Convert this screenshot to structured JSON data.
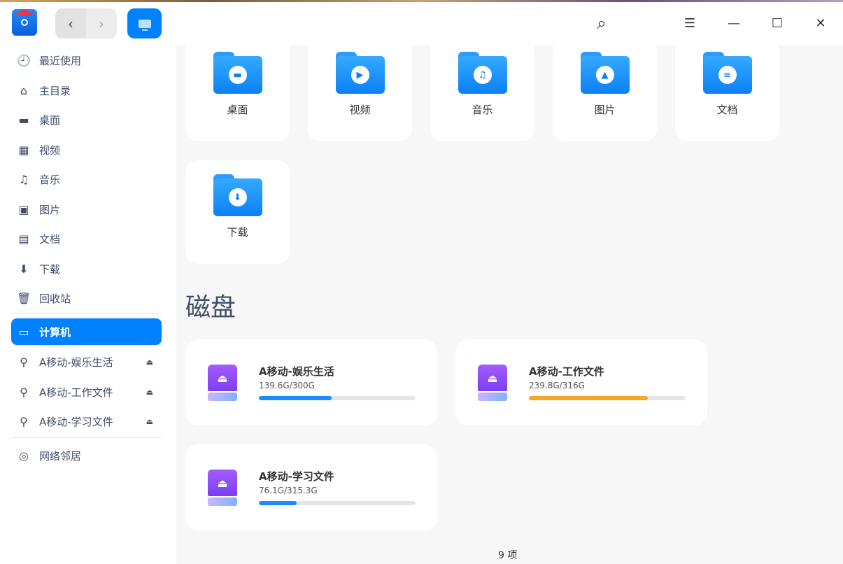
{
  "titlebar": {
    "app_icon": "file-manager-icon",
    "back": "‹",
    "forward": "›",
    "computer_icon": "computer-icon",
    "search_icon": "⌕",
    "menu_icon": "☰",
    "min_icon": "—",
    "max_icon": "☐",
    "close_icon": "✕"
  },
  "sidebar": {
    "items": [
      {
        "label": "最近使用",
        "icon": "🕘"
      },
      {
        "label": "主目录",
        "icon": "⌂"
      },
      {
        "label": "桌面",
        "icon": "▬"
      },
      {
        "label": "视频",
        "icon": "▦"
      },
      {
        "label": "音乐",
        "icon": "♫"
      },
      {
        "label": "图片",
        "icon": "▣"
      },
      {
        "label": "文档",
        "icon": "▤"
      },
      {
        "label": "下载",
        "icon": "⬇"
      },
      {
        "label": "回收站",
        "icon": "🗑"
      },
      {
        "label": "计算机",
        "icon": "▭"
      },
      {
        "label": "A移动-娱乐生活",
        "icon": "⚲"
      },
      {
        "label": "A移动-工作文件",
        "icon": "⚲"
      },
      {
        "label": "A移动-学习文件",
        "icon": "⚲"
      },
      {
        "label": "网络邻居",
        "icon": "◎"
      }
    ],
    "eject_icon": "⏏"
  },
  "folders": [
    {
      "label": "桌面",
      "icon": "▬"
    },
    {
      "label": "视频",
      "icon": "▶"
    },
    {
      "label": "音乐",
      "icon": "♫"
    },
    {
      "label": "图片",
      "icon": "▲"
    },
    {
      "label": "文档",
      "icon": "≡"
    },
    {
      "label": "下载",
      "icon": "⬇"
    }
  ],
  "disks_title": "磁盘",
  "disks": [
    {
      "name": "A移动-娱乐生活",
      "size": "139.6G/300G",
      "used_fraction": 0.465,
      "color": "#1a8cff"
    },
    {
      "name": "A移动-工作文件",
      "size": "239.8G/316G",
      "used_fraction": 0.759,
      "color": "#f5a623"
    },
    {
      "name": "A移动-学习文件",
      "size": "76.1G/315.3G",
      "used_fraction": 0.241,
      "color": "#1a8cff"
    }
  ],
  "disk_icon": "⏏",
  "footer": "9 项"
}
